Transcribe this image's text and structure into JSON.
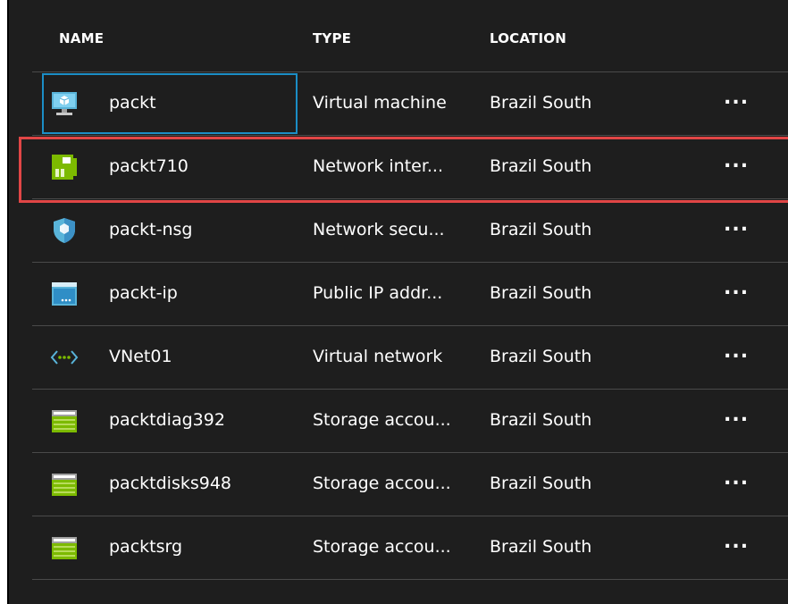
{
  "columns": {
    "name": "NAME",
    "type": "TYPE",
    "location": "LOCATION"
  },
  "more_label": "...",
  "rows": [
    {
      "name": "packt",
      "type": "Virtual machine",
      "location": "Brazil South",
      "icon": "virtual-machine-icon"
    },
    {
      "name": "packt710",
      "type": "Network inter...",
      "location": "Brazil South",
      "icon": "network-interface-icon"
    },
    {
      "name": "packt-nsg",
      "type": "Network secu...",
      "location": "Brazil South",
      "icon": "network-security-group-icon"
    },
    {
      "name": "packt-ip",
      "type": "Public IP addr...",
      "location": "Brazil South",
      "icon": "public-ip-icon"
    },
    {
      "name": "VNet01",
      "type": "Virtual network",
      "location": "Brazil South",
      "icon": "virtual-network-icon"
    },
    {
      "name": "packtdiag392",
      "type": "Storage accou...",
      "location": "Brazil South",
      "icon": "storage-account-icon"
    },
    {
      "name": "packtdisks948",
      "type": "Storage accou...",
      "location": "Brazil South",
      "icon": "storage-account-icon"
    },
    {
      "name": "packtsrg",
      "type": "Storage accou...",
      "location": "Brazil South",
      "icon": "storage-account-icon"
    }
  ],
  "colors": {
    "background": "#1e1e1e",
    "selection_border": "#1b8ec6",
    "highlight_border": "#e14646",
    "divider": "#4a4a4a"
  }
}
